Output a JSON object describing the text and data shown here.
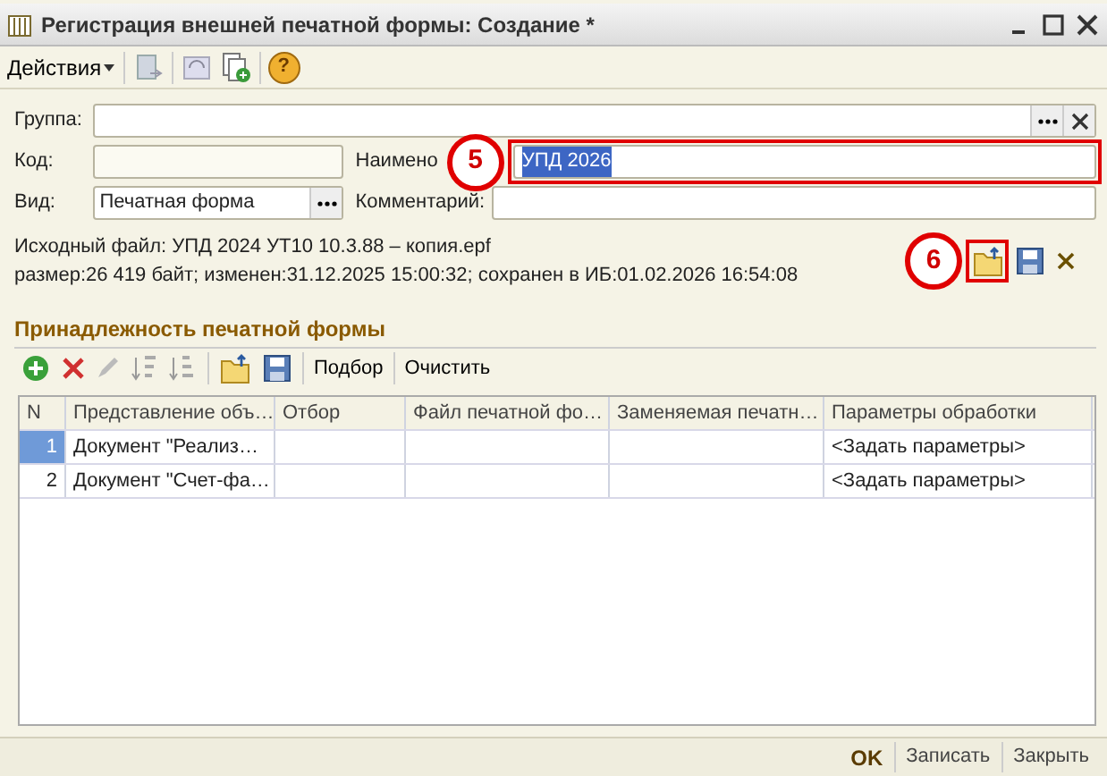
{
  "window": {
    "title": "Регистрация внешней печатной формы: Создание *"
  },
  "toolbar": {
    "actions_menu": "Действия",
    "help_glyph": "?"
  },
  "form": {
    "group": {
      "label": "Группа:"
    },
    "code": {
      "label": "Код:"
    },
    "name": {
      "label": "Наимено",
      "value": "УПД 2026",
      "text_selected": true
    },
    "kind": {
      "label": "Вид:",
      "value": "Печатная форма"
    },
    "comment": {
      "label": "Комментарий:"
    },
    "file_info": [
      "Исходный файл: УПД 2024 УТ10 10.3.88 – копия.epf",
      "размер:26 419 байт; изменен:31.12.2025 15:00:32; сохранен в ИБ:01.02.2026 16:54:08"
    ]
  },
  "section": {
    "title": "Принадлежность печатной формы",
    "buttons": [
      "Подбор",
      "Очистить"
    ]
  },
  "table": {
    "columns": [
      "N",
      "Представление объ…",
      "Отбор",
      "Файл печатной фо…",
      "Заменяемая печатн…",
      "Параметры обработки"
    ],
    "rows": [
      {
        "selected": true,
        "cells": [
          "1",
          "Документ \"Реализ…",
          "",
          "",
          "",
          "<Задать параметры>"
        ]
      },
      {
        "selected": false,
        "cells": [
          "2",
          "Документ \"Счет-фа…",
          "",
          "",
          "",
          "<Задать параметры>"
        ]
      }
    ]
  },
  "footer": {
    "buttons": [
      {
        "label": "OK",
        "default": true
      },
      {
        "label": "Записать",
        "default": false
      },
      {
        "label": "Закрыть",
        "default": false
      }
    ]
  },
  "callouts": [
    {
      "number": "5"
    },
    {
      "number": "6"
    }
  ]
}
